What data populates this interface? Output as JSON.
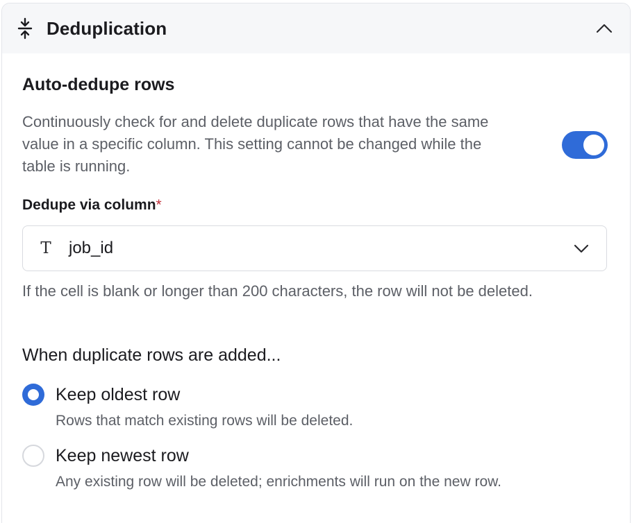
{
  "header": {
    "title": "Deduplication",
    "icon": "compress-vertical-icon",
    "collapse_icon": "chevron-up-icon"
  },
  "auto_dedupe": {
    "title": "Auto-dedupe rows",
    "description": "Continuously check for and delete duplicate rows that have the same value in a specific column. This setting cannot be changed while the table is running.",
    "enabled": true
  },
  "column_select": {
    "label": "Dedupe via column",
    "required_mark": "*",
    "type_icon": "T",
    "value": "job_id",
    "help": "If the cell is blank or longer than 200 characters, the row will not be deleted."
  },
  "duplicate_policy": {
    "question": "When duplicate rows are added...",
    "options": [
      {
        "label": "Keep oldest row",
        "description": "Rows that match existing rows will be deleted.",
        "selected": true
      },
      {
        "label": "Keep newest row",
        "description": "Any existing row will be deleted; enrichments will run on the new row.",
        "selected": false
      }
    ]
  },
  "colors": {
    "accent": "#2f6bd8",
    "required": "#c0313b",
    "header_bg": "#f6f7f9"
  }
}
